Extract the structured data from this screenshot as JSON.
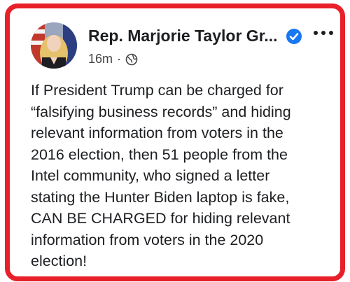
{
  "author": {
    "name": "Rep. Marjorie Taylor Gr...",
    "verified": true
  },
  "meta": {
    "time": "16m",
    "separator": "·",
    "audience_icon": "globe-icon"
  },
  "menu_icon": "more-options-icon",
  "post": {
    "lines": [
      "If President Trump can be charged for",
      "“falsifying business records” and hiding",
      "relevant information from voters in the",
      "2016 election, then 51 people from the",
      "Intel community, who signed a letter",
      "stating the Hunter Biden laptop is fake,",
      "CAN BE CHARGED for hiding relevant",
      "information from voters in the 2020",
      "election!"
    ]
  },
  "colors": {
    "frame_border": "#e8202a",
    "verified_badge": "#1877f2",
    "text": "#1c1e21"
  }
}
